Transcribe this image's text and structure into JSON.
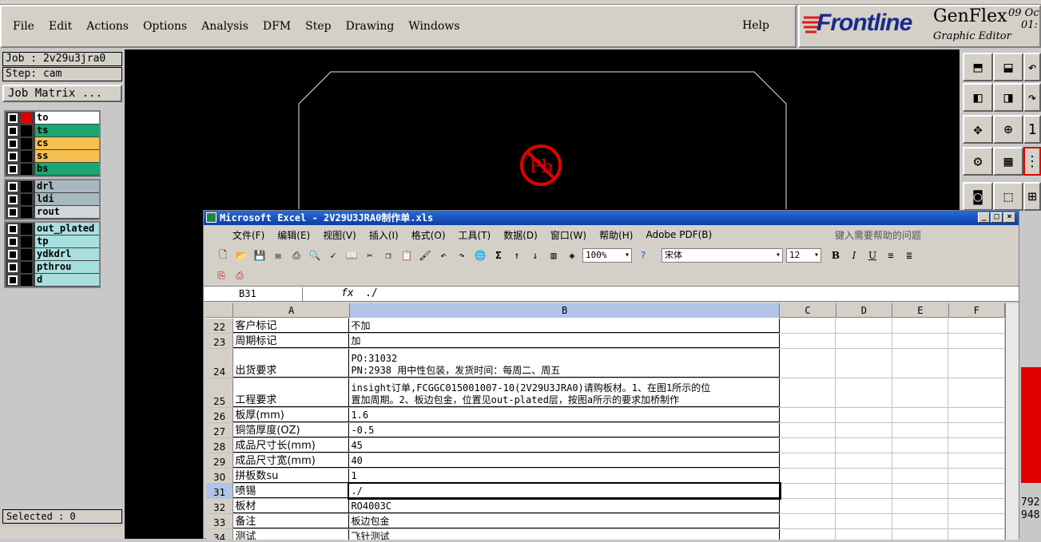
{
  "genflex": {
    "menu": [
      "File",
      "Edit",
      "Actions",
      "Options",
      "Analysis",
      "DFM",
      "Step",
      "Drawing",
      "Windows"
    ],
    "help": "Help",
    "brand": "Frontline",
    "product": "GenFlex",
    "product_sub": "Graphic Editor",
    "date_line1": "09 Oc",
    "date_line2": "01:",
    "job": "Job : 2v29u3jra0",
    "step": "Step: cam",
    "job_matrix": "Job Matrix ...",
    "layers_group1": [
      {
        "name": "to",
        "color": "#ffffff",
        "swatch": "#e00000"
      },
      {
        "name": "ts",
        "color": "#1aa870",
        "swatch": "#000000"
      },
      {
        "name": "cs",
        "color": "#f5c050",
        "swatch": "#000000"
      },
      {
        "name": "ss",
        "color": "#f5c050",
        "swatch": "#000000"
      },
      {
        "name": "bs",
        "color": "#1aa870",
        "swatch": "#000000"
      }
    ],
    "layers_group2": [
      {
        "name": "drl",
        "color": "#a8b8c0",
        "swatch": "#000000"
      },
      {
        "name": "ldi",
        "color": "#a8b8c0",
        "swatch": "#000000"
      },
      {
        "name": "rout",
        "color": "#d0d8dc",
        "swatch": "#000000"
      }
    ],
    "layers_group3": [
      {
        "name": "out_plated",
        "color": "#a8e0e0",
        "swatch": "#000000"
      },
      {
        "name": "tp",
        "color": "#a8e0e0",
        "swatch": "#000000"
      },
      {
        "name": "ydkdrl",
        "color": "#a8e0e0",
        "swatch": "#000000"
      },
      {
        "name": "pthrou",
        "color": "#a8e0e0",
        "swatch": "#000000"
      },
      {
        "name": "d",
        "color": "#a8e0e0",
        "swatch": "#000000"
      }
    ],
    "selected": "Selected : 0",
    "coord1": "792",
    "coord2": "948"
  },
  "excel": {
    "title": "Microsoft Excel - 2V29U3JRA0制作单.xls",
    "menu": [
      "文件(F)",
      "编辑(E)",
      "视图(V)",
      "插入(I)",
      "格式(O)",
      "工具(T)",
      "数据(D)",
      "窗口(W)",
      "帮助(H)",
      "Adobe PDF(B)"
    ],
    "help_placeholder": "键入需要帮助的问题",
    "zoom": "100%",
    "font": "宋体",
    "font_size": "12",
    "namebox": "B31",
    "fx": "fx",
    "formula": "./",
    "columns": [
      "A",
      "B",
      "C",
      "D",
      "E",
      "F"
    ],
    "rows": [
      {
        "n": "22",
        "a": "客户标记",
        "b": [
          "不加"
        ],
        "h": 19
      },
      {
        "n": "23",
        "a": "周期标记",
        "b": [
          "加"
        ],
        "h": 19
      },
      {
        "n": "24",
        "a": "出货要求",
        "b": [
          "PO:31032",
          "PN:2938 用中性包装，发货时间：每周二、周五"
        ],
        "h": 37
      },
      {
        "n": "25",
        "a": "工程要求",
        "b": [
          "insight订单,FCGGC015001007-10(2V29U3JRA0)请购板材。1、在图1所示的位",
          "置加周期。2、板边包金，位置见out-plated层，按图a所示的要求加桥制作"
        ],
        "h": 37
      },
      {
        "n": "26",
        "a": "板厚(mm)",
        "b": [
          "1.6"
        ],
        "h": 19
      },
      {
        "n": "27",
        "a": "铜箔厚度(OZ)",
        "b": [
          "-0.5"
        ],
        "h": 19
      },
      {
        "n": "28",
        "a": "成品尺寸长(mm)",
        "b": [
          "45"
        ],
        "h": 19
      },
      {
        "n": "29",
        "a": "成品尺寸宽(mm)",
        "b": [
          "40"
        ],
        "h": 19
      },
      {
        "n": "30",
        "a": "拼板数su",
        "b": [
          "1"
        ],
        "h": 19
      },
      {
        "n": "31",
        "a": "喷锡",
        "b": [
          "./"
        ],
        "h": 19,
        "sel": true
      },
      {
        "n": "32",
        "a": "板材",
        "b": [
          "RO4003C"
        ],
        "h": 19
      },
      {
        "n": "33",
        "a": "备注",
        "b": [
          "板边包金"
        ],
        "h": 19
      },
      {
        "n": "34",
        "a": "测试",
        "b": [
          "飞针测试"
        ],
        "h": 19
      }
    ]
  }
}
